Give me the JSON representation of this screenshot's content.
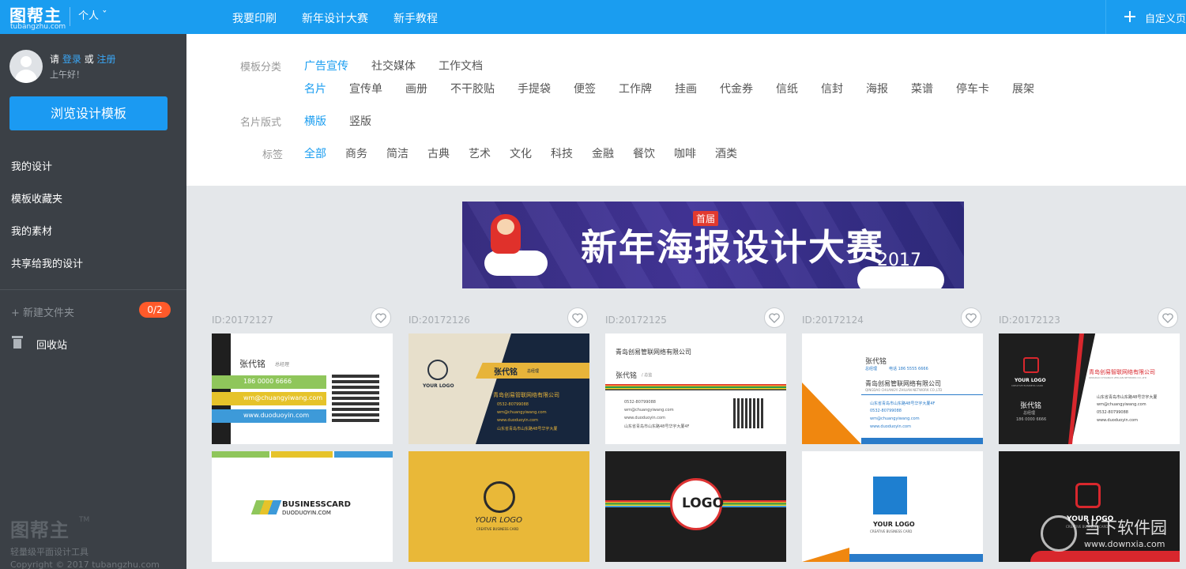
{
  "brand": {
    "name": "图帮主",
    "domain": "tubangzhu.com",
    "tm": "TM",
    "tagline": "轻量级平面设计工具",
    "copyright": "Copyright © 2017  tubangzhu.com"
  },
  "account": {
    "mode": "个人 ˇ"
  },
  "user": {
    "prompt_prefix": "请",
    "login": "登录",
    "or": "或",
    "register": "注册",
    "greeting": "上午好！"
  },
  "sidebar": {
    "browse_button": "浏览设计模板",
    "items": [
      {
        "label": "我的设计"
      },
      {
        "label": "模板收藏夹"
      },
      {
        "label": "我的素材"
      },
      {
        "label": "共享给我的设计"
      }
    ],
    "new_folder": "+  新建文件夹",
    "folder_count": "0/2",
    "recycle": "回收站"
  },
  "topnav": {
    "links": [
      "我要印刷",
      "新年设计大赛",
      "新手教程"
    ],
    "custom": "自定义页"
  },
  "filters": {
    "category_label": "模板分类",
    "categories": [
      "广告宣传",
      "社交媒体",
      "工作文档"
    ],
    "subcategories": [
      "名片",
      "宣传单",
      "画册",
      "不干胶贴",
      "手提袋",
      "便签",
      "工作牌",
      "挂画",
      "代金券",
      "信纸",
      "信封",
      "海报",
      "菜谱",
      "停车卡",
      "展架"
    ],
    "format_label": "名片版式",
    "formats": [
      "横版",
      "竖版"
    ],
    "tag_label": "标签",
    "tags": [
      "全部",
      "商务",
      "简洁",
      "古典",
      "艺术",
      "文化",
      "科技",
      "金融",
      "餐饮",
      "咖啡",
      "酒类"
    ]
  },
  "banner": {
    "badge": "首届",
    "title": "新年海报设计大赛",
    "year": "2017"
  },
  "templates": [
    {
      "id": "ID:20172127",
      "front": {
        "name": "张代铭",
        "title": "总经理",
        "phone": "186 0000 6666",
        "email": "wm@chuangyiwang.com",
        "web": "www.duoduoyin.com"
      },
      "back": {
        "brand": "BUSINESSCARD",
        "sub": "DUODUOYIN.COM"
      }
    },
    {
      "id": "ID:20172126",
      "front": {
        "name": "张代铭",
        "title": "总经理",
        "company": "青岛创易管联网络有限公司",
        "logo": "YOUR LOGO",
        "phone": "0532-80799088",
        "email": "wm@chuangyiwang.com",
        "web": "www.duoduoyin.com",
        "addr": "山东省青岛市山东路48号华宇大厦"
      },
      "back": {
        "logo": "YOUR LOGO",
        "sub": "CREATIVE BUSINESS CARD"
      }
    },
    {
      "id": "ID:20172125",
      "front": {
        "company": "青岛创易管联网络有限公司",
        "name": "张代铭",
        "title": "/ 总监",
        "phone": "0532-80799088",
        "email": "wm@chuangyiwang.com",
        "web": "www.duoduoyin.com",
        "addr": "山东省青岛市山东路48号华宇大厦4F"
      },
      "back": {
        "logo": "LOGO"
      }
    },
    {
      "id": "ID:20172124",
      "front": {
        "name": "张代铭",
        "title": "总经理",
        "mobile": "电话 186 5555 6666",
        "company": "青岛创易管联网络有限公司",
        "company_en": "QINGDAO CHUANGYI ZHILIAN NETWORK CO.,LTD",
        "addr": "山东省青岛市山东路48号华宇大厦4F",
        "phone": "0532-80799088",
        "email": "wm@chuangyiwang.com",
        "web": "www.duoduoyin.com"
      },
      "back": {
        "logo": "YOUR LOGO",
        "sub": "CREATIVE BUSINESS CARD"
      }
    },
    {
      "id": "ID:20172123",
      "front": {
        "logo": "YOUR LOGO",
        "logo_sub": "CREATIVE BUSINESS CARD",
        "company": "青岛创易智联网络有限公司",
        "company_en": "QINGDAO CHUANGYI ZHILIAN NETWORK CO.,LTD",
        "name": "张代铭",
        "title": "总经理",
        "mobile": "186 0000 6666",
        "addr": "山东省青岛市山东路48号华宇大厦",
        "email": "wm@chuangyiwang.com",
        "phone": "0532-80799088",
        "web": "www.duoduoyin.com"
      },
      "back": {
        "logo": "YOUR LOGO",
        "sub": "CREATIVE BUSINESS CARD"
      }
    }
  ],
  "watermark": {
    "name": "当下软件园",
    "url": "www.downxia.com"
  }
}
